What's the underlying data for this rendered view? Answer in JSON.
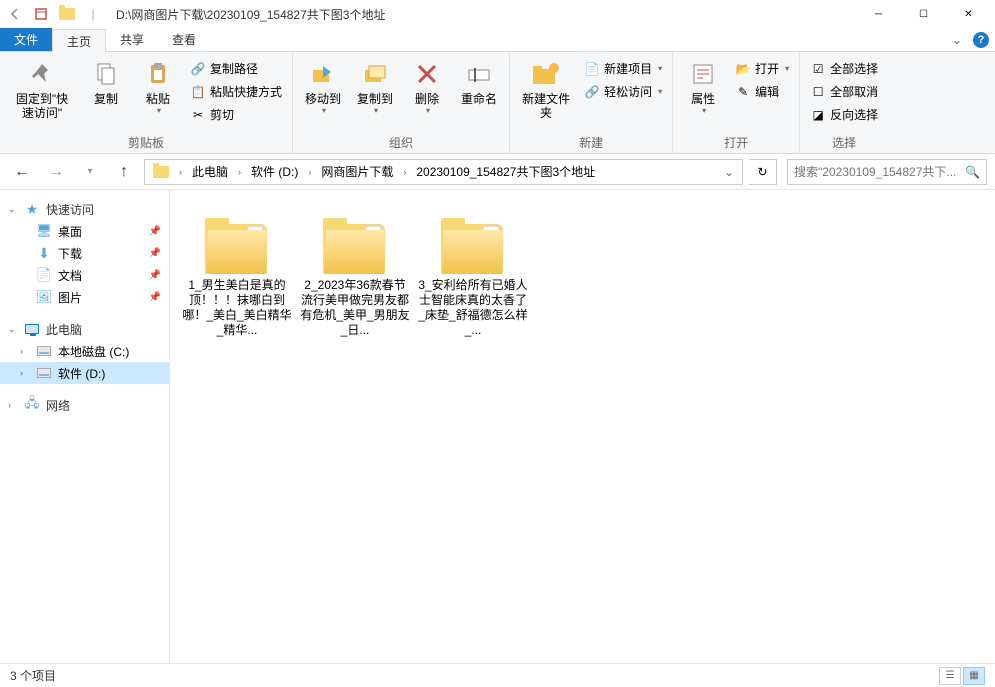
{
  "window": {
    "title_path": "D:\\网商图片下载\\20230109_154827共下图3个地址"
  },
  "tabs": {
    "file": "文件",
    "home": "主页",
    "share": "共享",
    "view": "查看"
  },
  "ribbon": {
    "clipboard": {
      "pin": "固定到\"快速访问\"",
      "copy": "复制",
      "paste": "粘贴",
      "copy_path": "复制路径",
      "paste_shortcut": "粘贴快捷方式",
      "cut": "剪切",
      "group_label": "剪贴板"
    },
    "organize": {
      "move_to": "移动到",
      "copy_to": "复制到",
      "delete": "删除",
      "rename": "重命名",
      "group_label": "组织"
    },
    "new": {
      "new_folder": "新建文件夹",
      "new_item": "新建项目",
      "easy_access": "轻松访问",
      "group_label": "新建"
    },
    "open": {
      "properties": "属性",
      "open": "打开",
      "edit": "编辑",
      "group_label": "打开"
    },
    "select": {
      "select_all": "全部选择",
      "select_none": "全部取消",
      "invert": "反向选择",
      "group_label": "选择"
    }
  },
  "breadcrumbs": {
    "this_pc": "此电脑",
    "drive": "软件 (D:)",
    "folder1": "网商图片下载",
    "folder2": "20230109_154827共下图3个地址"
  },
  "search": {
    "placeholder": "搜索\"20230109_154827共下..."
  },
  "nav": {
    "quick_access": "快速访问",
    "desktop": "桌面",
    "downloads": "下载",
    "documents": "文档",
    "pictures": "图片",
    "this_pc": "此电脑",
    "local_disk": "本地磁盘 (C:)",
    "software_disk": "软件 (D:)",
    "network": "网络"
  },
  "items": [
    {
      "name": "1_男生美白是真的顶！！！抹哪白到哪！_美白_美白精华_精华..."
    },
    {
      "name": "2_2023年36款春节流行美甲做完男友都有危机_美甲_男朋友_日..."
    },
    {
      "name": "3_安利给所有已婚人士智能床真的太香了_床垫_舒福德怎么样_..."
    }
  ],
  "status": {
    "count": "3 个项目"
  }
}
